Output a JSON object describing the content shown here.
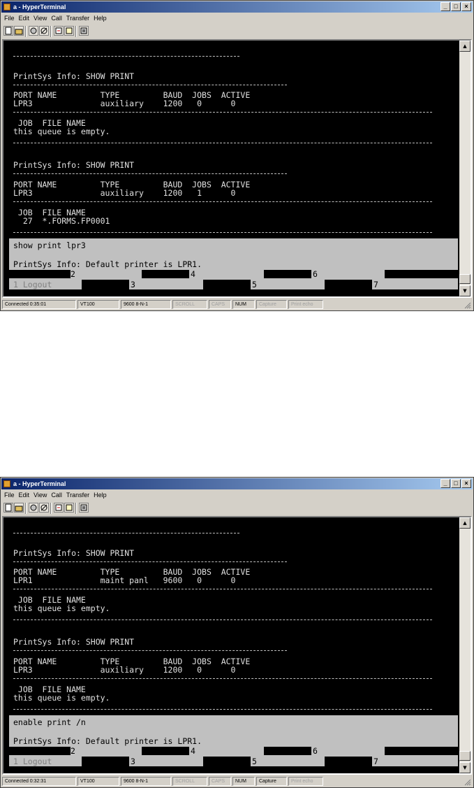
{
  "app": {
    "title": "a - HyperTerminal",
    "menu": [
      "File",
      "Edit",
      "View",
      "Call",
      "Transfer",
      "Help"
    ],
    "window_buttons": [
      "_",
      "□",
      "×"
    ]
  },
  "sessions": [
    {
      "screen": {
        "header_line": "PrintSys Info: SHOW PRINT",
        "block1": {
          "title": "PrintSys Info: SHOW PRINT",
          "port_header": "PORT NAME         TYPE         BAUD  JOBS  ACTIVE",
          "port_row": "LPR3              auxiliary    1200   0      0",
          "job_header": " JOB  FILE NAME",
          "job_row": "this queue is empty."
        },
        "block2": {
          "title": "PrintSys Info: SHOW PRINT",
          "port_header": "PORT NAME         TYPE         BAUD  JOBS  ACTIVE",
          "port_row": "LPR3              auxiliary    1200   1      0",
          "job_header": " JOB  FILE NAME",
          "job_row": "  27  *.FORMS.FP0001"
        },
        "command": "show print lpr3",
        "response": "PrintSys Info: Default printer is LPR1."
      },
      "fkeys_top": [
        "2",
        "4",
        "6"
      ],
      "fkeys_bottom": [
        "1 Logout",
        "3",
        "5",
        "7"
      ],
      "status": {
        "connected": "Connected 0:35:01",
        "emulation": "VT100",
        "settings": "9600 8-N-1",
        "scroll": "SCROLL",
        "caps": "CAPS",
        "num": "NUM",
        "capture": "Capture",
        "print_echo": "Print echo"
      }
    },
    {
      "screen": {
        "block1": {
          "title": "PrintSys Info: SHOW PRINT",
          "port_header": "PORT NAME         TYPE         BAUD  JOBS  ACTIVE",
          "port_row": "LPR1              maint panl   9600   0      0",
          "job_header": " JOB  FILE NAME",
          "job_row": "this queue is empty."
        },
        "block2": {
          "title": "PrintSys Info: SHOW PRINT",
          "port_header": "PORT NAME         TYPE         BAUD  JOBS  ACTIVE",
          "port_row": "LPR3              auxiliary    1200   0      0",
          "job_header": " JOB  FILE NAME",
          "job_row": "this queue is empty."
        },
        "command": "enable print /n",
        "response": "PrintSys Info: Default printer is LPR1."
      },
      "fkeys_top": [
        "2",
        "4",
        "6"
      ],
      "fkeys_bottom": [
        "1 Logout",
        "3",
        "5",
        "7"
      ],
      "status": {
        "connected": "Connected 0:32:31",
        "emulation": "VT100",
        "settings": "9600 8-N-1",
        "scroll": "SCROLL",
        "caps": "CAPS",
        "num": "NUM",
        "capture": "Capture",
        "print_echo": "Print echo"
      }
    }
  ],
  "icons": {
    "app": "hyperterminal-app-icon",
    "toolbar": [
      "new-icon",
      "open-icon",
      "connect-icon",
      "disconnect-icon",
      "send-icon",
      "receive-icon",
      "properties-icon"
    ]
  }
}
